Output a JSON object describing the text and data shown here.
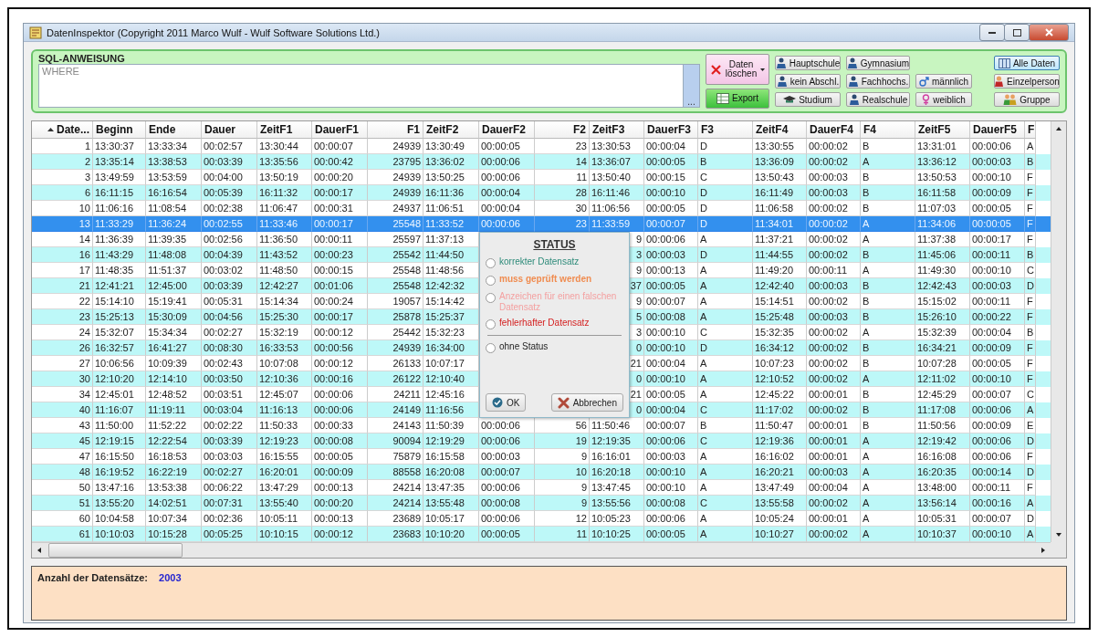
{
  "window": {
    "title": "DatenInspektor (Copyright 2011 Marco Wulf - Wulf Software Solutions Ltd.)"
  },
  "sql_panel": {
    "label": "SQL-ANWEISUNG",
    "query": {
      "placeholder": "WHERE"
    },
    "browse_button": "...",
    "actions": [
      {
        "kind": "delete",
        "label": "Daten löschen"
      },
      {
        "kind": "export",
        "label": "Export"
      }
    ],
    "filter_columns": [
      [
        {
          "kind": "person",
          "label": "Hauptschule",
          "selected": false
        },
        {
          "kind": "person",
          "label": "kein Abschl.",
          "selected": false
        },
        {
          "kind": "cap",
          "label": "Studium",
          "selected": false
        }
      ],
      [
        {
          "kind": "person",
          "label": "Gymnasium",
          "selected": false
        },
        {
          "kind": "person",
          "label": "Fachhochs.",
          "selected": false
        },
        {
          "kind": "person",
          "label": "Realschule",
          "selected": false
        }
      ],
      [
        {
          "kind": "male",
          "label": "männlich",
          "selected": false
        },
        {
          "kind": "female",
          "label": "weiblich",
          "selected": false
        }
      ],
      [
        {
          "kind": "grid",
          "label": "Alle Daten",
          "selected": true
        },
        {
          "kind": "single",
          "label": "Einzelperson",
          "selected": false
        },
        {
          "kind": "group",
          "label": "Gruppe",
          "selected": false
        }
      ]
    ]
  },
  "table": {
    "columns": [
      {
        "label": "Date...",
        "kind": "number",
        "sorted": true
      },
      {
        "label": "Beginn",
        "kind": "text",
        "sorted": false
      },
      {
        "label": "Ende",
        "kind": "text",
        "sorted": false
      },
      {
        "label": "Dauer",
        "kind": "text",
        "sorted": false
      },
      {
        "label": "ZeitF1",
        "kind": "text",
        "sorted": false
      },
      {
        "label": "DauerF1",
        "kind": "text",
        "sorted": false
      },
      {
        "label": "F1",
        "kind": "number",
        "sorted": false
      },
      {
        "label": "ZeitF2",
        "kind": "text",
        "sorted": false
      },
      {
        "label": "DauerF2",
        "kind": "text",
        "sorted": false
      },
      {
        "label": "F2",
        "kind": "number",
        "sorted": false
      },
      {
        "label": "ZeitF3",
        "kind": "text",
        "sorted": false
      },
      {
        "label": "DauerF3",
        "kind": "text",
        "sorted": false
      },
      {
        "label": "F3",
        "kind": "text",
        "sorted": false
      },
      {
        "label": "ZeitF4",
        "kind": "text",
        "sorted": false
      },
      {
        "label": "DauerF4",
        "kind": "text",
        "sorted": false
      },
      {
        "label": "F4",
        "kind": "text",
        "sorted": false
      },
      {
        "label": "ZeitF5",
        "kind": "text",
        "sorted": false
      },
      {
        "label": "DauerF5",
        "kind": "text",
        "sorted": false
      },
      {
        "label": "F",
        "kind": "text",
        "sorted": false
      }
    ],
    "rows": [
      {
        "kind": "plain",
        "selected": false,
        "cells": [
          "1",
          "13:30:37",
          "13:33:34",
          "00:02:57",
          "13:30:44",
          "00:00:07",
          "24939",
          "13:30:49",
          "00:00:05",
          "23",
          "13:30:53",
          "00:00:04",
          "D",
          "13:30:55",
          "00:00:02",
          "B",
          "13:31:01",
          "00:00:06",
          "A"
        ]
      },
      {
        "kind": "plain",
        "selected": false,
        "cells": [
          "2",
          "13:35:14",
          "13:38:53",
          "00:03:39",
          "13:35:56",
          "00:00:42",
          "23795",
          "13:36:02",
          "00:00:06",
          "14",
          "13:36:07",
          "00:00:05",
          "B",
          "13:36:09",
          "00:00:02",
          "A",
          "13:36:12",
          "00:00:03",
          "B"
        ]
      },
      {
        "kind": "plain",
        "selected": false,
        "cells": [
          "3",
          "13:49:59",
          "13:53:59",
          "00:04:00",
          "13:50:19",
          "00:00:20",
          "24939",
          "13:50:25",
          "00:00:06",
          "11",
          "13:50:40",
          "00:00:15",
          "C",
          "13:50:43",
          "00:00:03",
          "B",
          "13:50:53",
          "00:00:10",
          "F"
        ]
      },
      {
        "kind": "plain",
        "selected": false,
        "cells": [
          "6",
          "16:11:15",
          "16:16:54",
          "00:05:39",
          "16:11:32",
          "00:00:17",
          "24939",
          "16:11:36",
          "00:00:04",
          "28",
          "16:11:46",
          "00:00:10",
          "D",
          "16:11:49",
          "00:00:03",
          "B",
          "16:11:58",
          "00:00:09",
          "F"
        ]
      },
      {
        "kind": "plain",
        "selected": false,
        "cells": [
          "10",
          "11:06:16",
          "11:08:54",
          "00:02:38",
          "11:06:47",
          "00:00:31",
          "24937",
          "11:06:51",
          "00:00:04",
          "30",
          "11:06:56",
          "00:00:05",
          "D",
          "11:06:58",
          "00:00:02",
          "B",
          "11:07:03",
          "00:00:05",
          "F"
        ]
      },
      {
        "kind": "plain",
        "selected": true,
        "cells": [
          "13",
          "11:33:29",
          "11:36:24",
          "00:02:55",
          "11:33:46",
          "00:00:17",
          "25548",
          "11:33:52",
          "00:00:06",
          "23",
          "11:33:59",
          "00:00:07",
          "D",
          "11:34:01",
          "00:00:02",
          "A",
          "11:34:06",
          "00:00:05",
          "F"
        ]
      },
      {
        "kind": "partly-covered",
        "selected": false,
        "cells": [
          "14",
          "11:36:39",
          "11:39:35",
          "00:02:56",
          "11:36:50",
          "00:00:11",
          "25597",
          "11:37:13",
          null,
          null,
          "9",
          "00:00:06",
          "A",
          "11:37:21",
          "00:00:02",
          "A",
          "11:37:38",
          "00:00:17",
          "F"
        ]
      },
      {
        "kind": "partly-covered",
        "selected": false,
        "cells": [
          "16",
          "11:43:29",
          "11:48:08",
          "00:04:39",
          "11:43:52",
          "00:00:23",
          "25542",
          "11:44:50",
          null,
          null,
          "3",
          "00:00:03",
          "D",
          "11:44:55",
          "00:00:02",
          "B",
          "11:45:06",
          "00:00:11",
          "B"
        ]
      },
      {
        "kind": "partly-covered",
        "selected": false,
        "cells": [
          "17",
          "11:48:35",
          "11:51:37",
          "00:03:02",
          "11:48:50",
          "00:00:15",
          "25548",
          "11:48:56",
          null,
          null,
          "9",
          "00:00:13",
          "A",
          "11:49:20",
          "00:00:11",
          "A",
          "11:49:30",
          "00:00:10",
          "C"
        ]
      },
      {
        "kind": "partly-covered",
        "selected": false,
        "cells": [
          "21",
          "12:41:21",
          "12:45:00",
          "00:03:39",
          "12:42:27",
          "00:01:06",
          "25548",
          "12:42:32",
          null,
          null,
          "37",
          "00:00:05",
          "A",
          "12:42:40",
          "00:00:03",
          "B",
          "12:42:43",
          "00:00:03",
          "D"
        ]
      },
      {
        "kind": "partly-covered",
        "selected": false,
        "cells": [
          "22",
          "15:14:10",
          "15:19:41",
          "00:05:31",
          "15:14:34",
          "00:00:24",
          "19057",
          "15:14:42",
          null,
          null,
          "9",
          "00:00:07",
          "A",
          "15:14:51",
          "00:00:02",
          "B",
          "15:15:02",
          "00:00:11",
          "F"
        ]
      },
      {
        "kind": "partly-covered",
        "selected": false,
        "cells": [
          "23",
          "15:25:13",
          "15:30:09",
          "00:04:56",
          "15:25:30",
          "00:00:17",
          "25878",
          "15:25:37",
          null,
          null,
          "5",
          "00:00:08",
          "A",
          "15:25:48",
          "00:00:03",
          "B",
          "15:26:10",
          "00:00:22",
          "F"
        ]
      },
      {
        "kind": "partly-covered",
        "selected": false,
        "cells": [
          "24",
          "15:32:07",
          "15:34:34",
          "00:02:27",
          "15:32:19",
          "00:00:12",
          "25442",
          "15:32:23",
          null,
          null,
          "3",
          "00:00:10",
          "C",
          "15:32:35",
          "00:00:02",
          "A",
          "15:32:39",
          "00:00:04",
          "B"
        ]
      },
      {
        "kind": "partly-covered",
        "selected": false,
        "cells": [
          "26",
          "16:32:57",
          "16:41:27",
          "00:08:30",
          "16:33:53",
          "00:00:56",
          "24939",
          "16:34:00",
          null,
          null,
          "0",
          "00:00:10",
          "D",
          "16:34:12",
          "00:00:02",
          "B",
          "16:34:21",
          "00:00:09",
          "F"
        ]
      },
      {
        "kind": "partly-covered",
        "selected": false,
        "cells": [
          "27",
          "10:06:56",
          "10:09:39",
          "00:02:43",
          "10:07:08",
          "00:00:12",
          "26133",
          "10:07:17",
          null,
          null,
          "21",
          "00:00:04",
          "A",
          "10:07:23",
          "00:00:02",
          "B",
          "10:07:28",
          "00:00:05",
          "F"
        ]
      },
      {
        "kind": "partly-covered",
        "selected": false,
        "cells": [
          "30",
          "12:10:20",
          "12:14:10",
          "00:03:50",
          "12:10:36",
          "00:00:16",
          "26122",
          "12:10:40",
          null,
          null,
          "0",
          "00:00:10",
          "A",
          "12:10:52",
          "00:00:02",
          "A",
          "12:11:02",
          "00:00:10",
          "F"
        ]
      },
      {
        "kind": "partly-covered",
        "selected": false,
        "cells": [
          "34",
          "12:45:01",
          "12:48:52",
          "00:03:51",
          "12:45:07",
          "00:00:06",
          "24211",
          "12:45:16",
          null,
          null,
          "21",
          "00:00:05",
          "A",
          "12:45:22",
          "00:00:01",
          "B",
          "12:45:29",
          "00:00:07",
          "C"
        ]
      },
      {
        "kind": "partly-covered",
        "selected": false,
        "cells": [
          "40",
          "11:16:07",
          "11:19:11",
          "00:03:04",
          "11:16:13",
          "00:00:06",
          "24149",
          "11:16:56",
          null,
          null,
          "0",
          "00:00:04",
          "C",
          "11:17:02",
          "00:00:02",
          "B",
          "11:17:08",
          "00:00:06",
          "A"
        ]
      },
      {
        "kind": "plain",
        "selected": false,
        "cells": [
          "43",
          "11:50:00",
          "11:52:22",
          "00:02:22",
          "11:50:33",
          "00:00:33",
          "24143",
          "11:50:39",
          "00:00:06",
          "56",
          "11:50:46",
          "00:00:07",
          "B",
          "11:50:47",
          "00:00:01",
          "B",
          "11:50:56",
          "00:00:09",
          "E"
        ]
      },
      {
        "kind": "plain",
        "selected": false,
        "cells": [
          "45",
          "12:19:15",
          "12:22:54",
          "00:03:39",
          "12:19:23",
          "00:00:08",
          "90094",
          "12:19:29",
          "00:00:06",
          "19",
          "12:19:35",
          "00:00:06",
          "C",
          "12:19:36",
          "00:00:01",
          "A",
          "12:19:42",
          "00:00:06",
          "D"
        ]
      },
      {
        "kind": "plain",
        "selected": false,
        "cells": [
          "47",
          "16:15:50",
          "16:18:53",
          "00:03:03",
          "16:15:55",
          "00:00:05",
          "75879",
          "16:15:58",
          "00:00:03",
          "9",
          "16:16:01",
          "00:00:03",
          "A",
          "16:16:02",
          "00:00:01",
          "A",
          "16:16:08",
          "00:00:06",
          "F"
        ]
      },
      {
        "kind": "plain",
        "selected": false,
        "cells": [
          "48",
          "16:19:52",
          "16:22:19",
          "00:02:27",
          "16:20:01",
          "00:00:09",
          "88558",
          "16:20:08",
          "00:00:07",
          "10",
          "16:20:18",
          "00:00:10",
          "A",
          "16:20:21",
          "00:00:03",
          "A",
          "16:20:35",
          "00:00:14",
          "D"
        ]
      },
      {
        "kind": "plain",
        "selected": false,
        "cells": [
          "50",
          "13:47:16",
          "13:53:38",
          "00:06:22",
          "13:47:29",
          "00:00:13",
          "24214",
          "13:47:35",
          "00:00:06",
          "9",
          "13:47:45",
          "00:00:10",
          "A",
          "13:47:49",
          "00:00:04",
          "A",
          "13:48:00",
          "00:00:11",
          "F"
        ]
      },
      {
        "kind": "plain",
        "selected": false,
        "cells": [
          "51",
          "13:55:20",
          "14:02:51",
          "00:07:31",
          "13:55:40",
          "00:00:20",
          "24214",
          "13:55:48",
          "00:00:08",
          "9",
          "13:55:56",
          "00:00:08",
          "C",
          "13:55:58",
          "00:00:02",
          "A",
          "13:56:14",
          "00:00:16",
          "A"
        ]
      },
      {
        "kind": "plain",
        "selected": false,
        "cells": [
          "60",
          "10:04:58",
          "10:07:34",
          "00:02:36",
          "10:05:11",
          "00:00:13",
          "23689",
          "10:05:17",
          "00:00:06",
          "12",
          "10:05:23",
          "00:00:06",
          "A",
          "10:05:24",
          "00:00:01",
          "A",
          "10:05:31",
          "00:00:07",
          "D"
        ]
      },
      {
        "kind": "plain",
        "selected": false,
        "cells": [
          "61",
          "10:10:03",
          "10:15:28",
          "00:05:25",
          "10:10:15",
          "00:00:12",
          "23683",
          "10:10:20",
          "00:00:05",
          "11",
          "10:10:25",
          "00:00:05",
          "A",
          "10:10:27",
          "00:00:02",
          "A",
          "10:10:37",
          "00:00:10",
          "A"
        ]
      }
    ]
  },
  "status_dialog": {
    "title": "STATUS",
    "options": [
      {
        "label": "korrekter Datensatz",
        "color": "#2e8b7a",
        "selected": false
      },
      {
        "label": "muss geprüft werden",
        "color": "#f08c50",
        "selected": false
      },
      {
        "label": "Anzeichen für einen falschen Datensatz",
        "color": "#f4a0a0",
        "selected": false
      },
      {
        "label": "fehlerhafter Datensatz",
        "color": "#d42020",
        "selected": false
      },
      {
        "label": "ohne Status",
        "selected": false
      }
    ],
    "buttons": [
      {
        "kind": "ok",
        "label": "OK"
      },
      {
        "kind": "cancel",
        "label": "Abbrechen"
      }
    ]
  },
  "footer": {
    "label": "Anzahl der Datensätze:",
    "value": "2003"
  }
}
